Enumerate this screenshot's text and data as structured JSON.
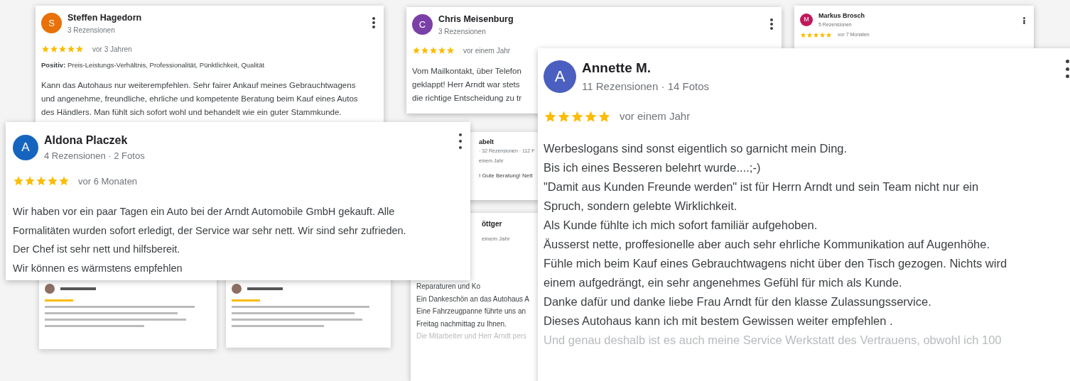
{
  "reviews": [
    {
      "kind": "review",
      "avatar": "S",
      "color": "#e8710a",
      "name": "Steffen Hagedorn",
      "meta": "3 Rezensionen",
      "stars": 5,
      "time": "vor 3 Jahren",
      "positive": "**Positiv:** Preis-Leistungs-Verhältnis, Professionalität, Pünktlichkeit, Qualität",
      "lines": [
        {
          "text": "Kann das Autohaus nur weiterempfehlen. Sehr fairer Ankauf meines Gebrauchtwagens",
          "faded": false
        },
        {
          "text": "und angenehme, freundliche, ehrliche und kompetente Beratung beim Kauf eines Autos",
          "faded": false
        },
        {
          "text": "des Händlers. Man fühlt sich sofort wohl und behandelt wie ein guter Stammkunde.",
          "faded": false
        }
      ]
    },
    {
      "kind": "review",
      "avatar": "C",
      "color": "#7b3fa8",
      "name": "Chris Meisenburg",
      "meta": "3 Rezensionen",
      "stars": 5,
      "time": "vor einem Jahr",
      "lines": [
        {
          "text": "Vom Mailkontakt, über Telefon",
          "faded": false
        },
        {
          "text": "geklappt! Herr Arndt war stets",
          "faded": false
        },
        {
          "text": "die richtige Entscheidung zu tr",
          "faded": false
        }
      ]
    },
    {
      "kind": "review",
      "avatar": "M",
      "color": "#c2185b",
      "name": "Markus Brosch",
      "meta": "5 Rezensionen",
      "stars": 5,
      "time": "vor 7 Monaten"
    },
    {
      "kind": "partial",
      "name": "abelt",
      "meta": "· 32 Rezensionen · 112 F",
      "time": "einem Jahr",
      "lines": [
        {
          "text": "! Gute Beratung! Nett",
          "faded": false
        }
      ]
    },
    {
      "kind": "partial",
      "name": "öttger",
      "time": "einem Jahr",
      "lines": [
        {
          "text": "Reparaturen und Ko",
          "faded": false
        },
        {
          "text": "Ein Dankeschön an das Autohaus A",
          "faded": false
        },
        {
          "text": "Eine Fahrzeugpanne führte uns an",
          "faded": false
        },
        {
          "text": "Freitag nachmittag zu Ihnen.",
          "faded": false
        },
        {
          "text": "Die Mitarbeiter und Herr Arndt pers",
          "faded": true
        }
      ]
    },
    {
      "kind": "blurred"
    },
    {
      "kind": "blurred"
    },
    {
      "kind": "review",
      "avatar": "A",
      "color": "#1565c0",
      "name": "Aldona Placzek",
      "meta": "4 Rezensionen · 2 Fotos",
      "stars": 5,
      "time": "vor 6 Monaten",
      "lines": [
        {
          "text": "Wir haben vor ein paar Tagen ein Auto bei der Arndt Automobile GmbH gekauft. Alle",
          "faded": false
        },
        {
          "text": "Formalitäten wurden sofort erledigt, der Service war sehr nett. Wir sind sehr zufrieden.",
          "faded": false
        },
        {
          "text": "Der Chef ist sehr nett und hilfsbereit.",
          "faded": false
        },
        {
          "text": "Wir können es wärmstens empfehlen",
          "faded": false
        }
      ]
    },
    {
      "kind": "review",
      "avatar": "A",
      "color": "#4a5fbf",
      "name": "Annette M.",
      "meta": "11 Rezensionen · 14 Fotos",
      "stars": 5,
      "time": "vor einem Jahr",
      "lines": [
        {
          "text": "Werbeslogans sind sonst eigentlich so garnicht mein Ding.",
          "faded": false
        },
        {
          "text": "Bis ich eines Besseren belehrt wurde....;-)",
          "faded": false
        },
        {
          "text": "\"Damit aus Kunden Freunde werden\" ist für Herrn Arndt und sein Team nicht nur ein",
          "faded": false
        },
        {
          "text": "Spruch, sondern gelebte Wirklichkeit.",
          "faded": false
        },
        {
          "text": "Als Kunde fühlte ich mich sofort familiär aufgehoben.",
          "faded": false
        },
        {
          "text": "Äusserst nette, proffesionelle aber auch sehr ehrliche Kommunikation auf Augenhöhe.",
          "faded": false
        },
        {
          "text": "Fühle mich beim Kauf eines Gebrauchtwagens nicht über den Tisch gezogen. Nichts wird",
          "faded": false
        },
        {
          "text": "einem aufgedrängt, ein sehr angenehmes Gefühl für mich als Kunde.",
          "faded": false
        },
        {
          "text": "Danke dafür und danke liebe Frau Arndt für den klasse Zulassungsservice.",
          "faded": false
        },
        {
          "text": "Dieses Autohaus kann ich mit bestem Gewissen weiter empfehlen .",
          "faded": false
        },
        {
          "text": "Und genau deshalb ist es auch meine Service Werkstatt des Vertrauens, obwohl ich 100",
          "faded": true
        }
      ]
    }
  ]
}
